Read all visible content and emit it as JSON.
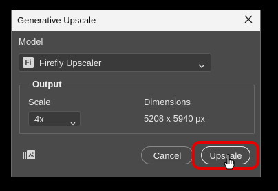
{
  "dialog": {
    "title": "Generative Upscale",
    "model_label": "Model",
    "model_value": "Firefly Upscaler",
    "model_icon": "Fi",
    "output_legend": "Output",
    "scale_label": "Scale",
    "scale_value": "4x",
    "dimensions_label": "Dimensions",
    "dimensions_value": "5208 x 5940 px",
    "cancel_label": "Cancel",
    "upscale_label": "Upscale"
  },
  "colors": {
    "highlight": "#e60000",
    "dialog_bg": "#4a4a4a",
    "titlebar_bg": "#f3f3f3"
  },
  "icons": {
    "close": "close-icon",
    "chevron": "chevron-down-icon",
    "compare": "compare-icon",
    "cursor": "mouse-pointer-icon"
  }
}
